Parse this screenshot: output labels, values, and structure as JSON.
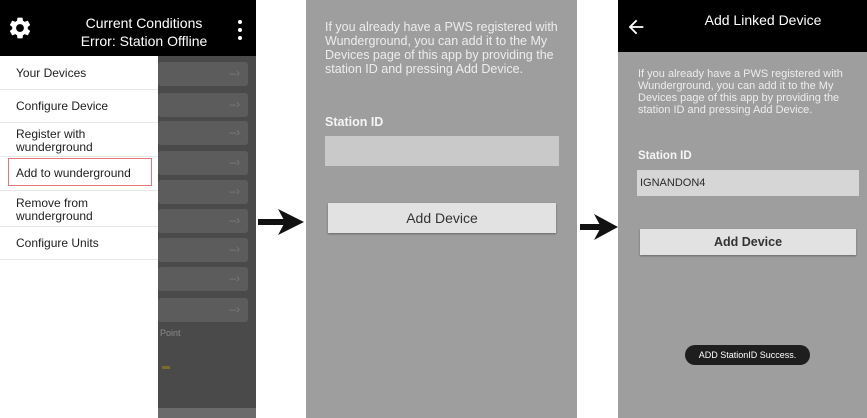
{
  "screen1": {
    "title_line1": "Current Conditions",
    "title_line2": "Error: Station Offline",
    "menu": [
      {
        "label": "Your Devices"
      },
      {
        "label": "Configure Device"
      },
      {
        "label_line1": "Register with",
        "label_line2": "wunderground"
      },
      {
        "label": "Add to wunderground"
      },
      {
        "label_line1": "Remove from",
        "label_line2": "wunderground"
      },
      {
        "label": "Configure Units"
      }
    ],
    "background_partial_text": "Point",
    "row_chevron": "–›"
  },
  "screen2": {
    "info_text": "If you already have a PWS registered with Wunderground, you can add it to the My Devices page of this app by providing the station ID and pressing Add Device.",
    "station_label": "Station ID",
    "station_value": "",
    "button_label": "Add Device"
  },
  "screen3": {
    "title": "Add Linked Device",
    "info_text": "If you already have a PWS registered with Wunderground, you can add it to the My Devices page of this app by providing the station ID and pressing Add Device.",
    "station_label": "Station ID",
    "station_value": "IGNANDON4",
    "button_label": "Add Device",
    "toast": "ADD StationID Success."
  },
  "colors": {
    "topbar": "#000000",
    "screen_bg": "#9e9e9e",
    "button_bg": "#e2e2e2",
    "highlight_border": "#e07a7a"
  }
}
